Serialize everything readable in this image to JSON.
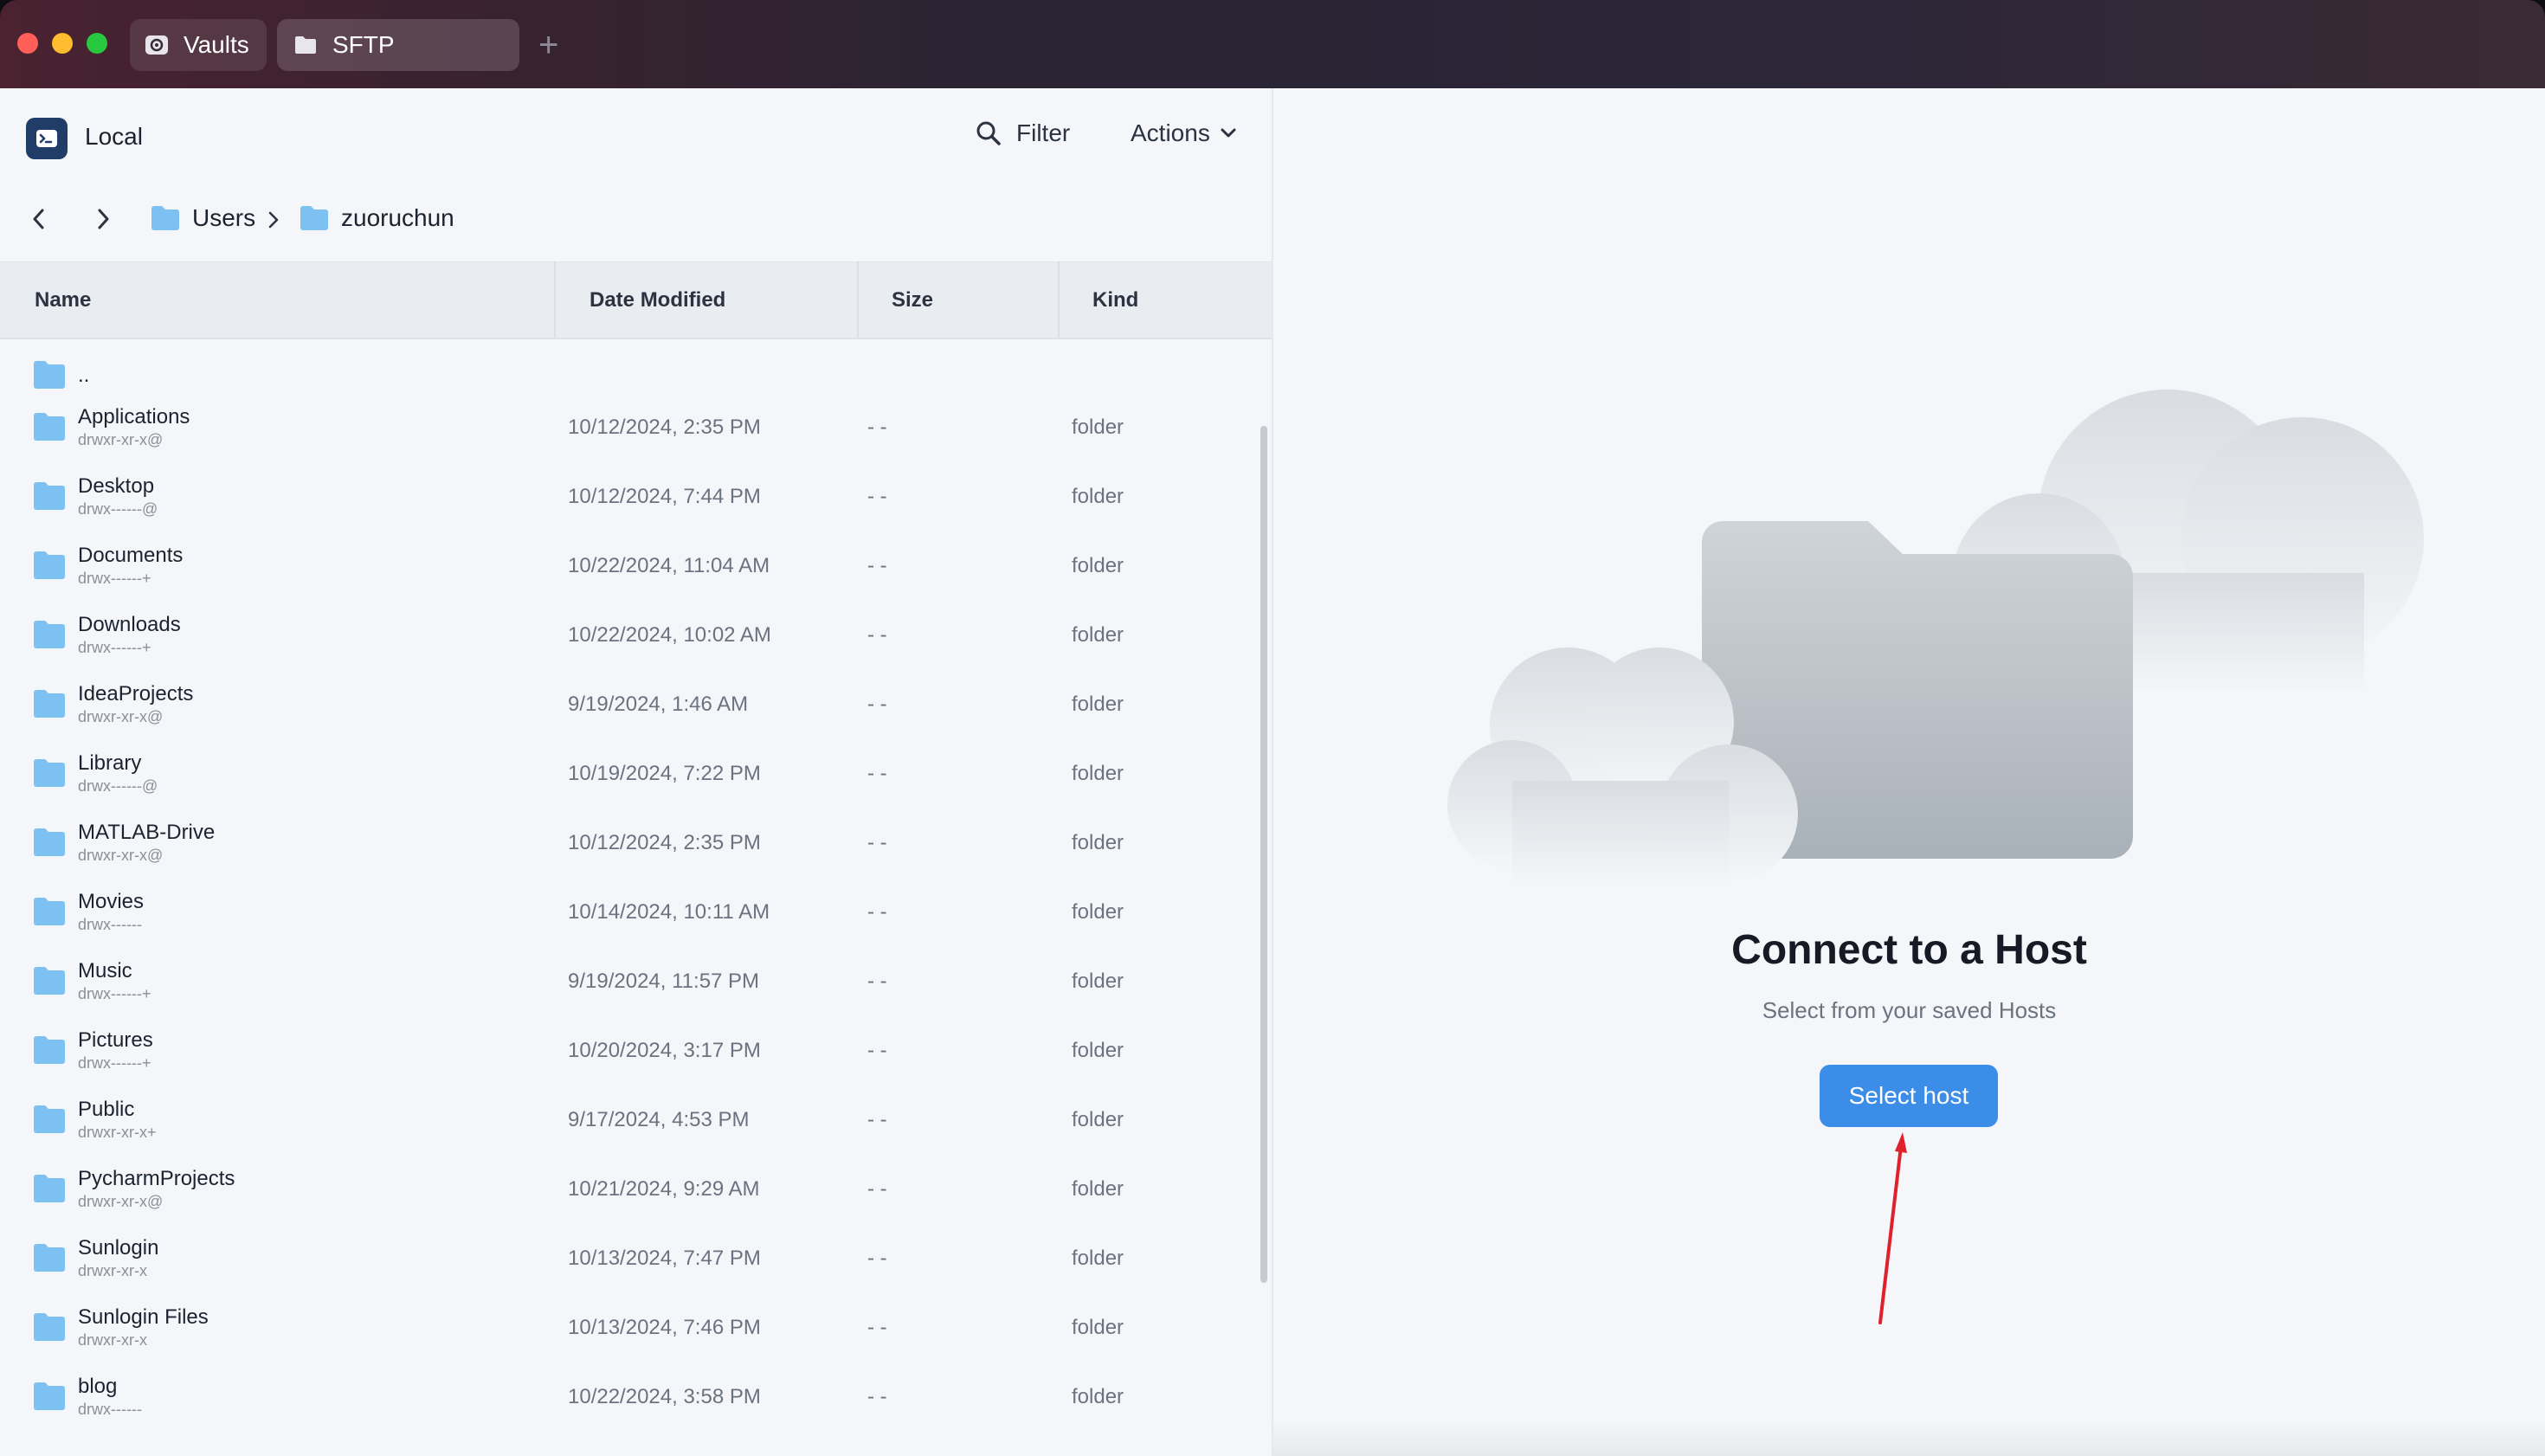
{
  "window": {
    "tabs": [
      {
        "label": "Vaults",
        "icon": "vault-icon"
      },
      {
        "label": "SFTP",
        "icon": "folder-icon"
      }
    ],
    "new_tab_icon": "plus-icon"
  },
  "left_pane": {
    "location_label": "Local",
    "filter_label": "Filter",
    "actions_label": "Actions",
    "breadcrumb": [
      "Users",
      "zuoruchun"
    ],
    "columns": [
      "Name",
      "Date Modified",
      "Size",
      "Kind"
    ],
    "parent_entry": "..",
    "files": [
      {
        "name": "Applications",
        "perm": "drwxr-xr-x@",
        "date": "10/12/2024, 2:35 PM",
        "size": "- -",
        "kind": "folder"
      },
      {
        "name": "Desktop",
        "perm": "drwx------@",
        "date": "10/12/2024, 7:44 PM",
        "size": "- -",
        "kind": "folder"
      },
      {
        "name": "Documents",
        "perm": "drwx------+",
        "date": "10/22/2024, 11:04 AM",
        "size": "- -",
        "kind": "folder"
      },
      {
        "name": "Downloads",
        "perm": "drwx------+",
        "date": "10/22/2024, 10:02 AM",
        "size": "- -",
        "kind": "folder"
      },
      {
        "name": "IdeaProjects",
        "perm": "drwxr-xr-x@",
        "date": "9/19/2024, 1:46 AM",
        "size": "- -",
        "kind": "folder"
      },
      {
        "name": "Library",
        "perm": "drwx------@",
        "date": "10/19/2024, 7:22 PM",
        "size": "- -",
        "kind": "folder"
      },
      {
        "name": "MATLAB-Drive",
        "perm": "drwxr-xr-x@",
        "date": "10/12/2024, 2:35 PM",
        "size": "- -",
        "kind": "folder"
      },
      {
        "name": "Movies",
        "perm": "drwx------",
        "date": "10/14/2024, 10:11 AM",
        "size": "- -",
        "kind": "folder"
      },
      {
        "name": "Music",
        "perm": "drwx------+",
        "date": "9/19/2024, 11:57 PM",
        "size": "- -",
        "kind": "folder"
      },
      {
        "name": "Pictures",
        "perm": "drwx------+",
        "date": "10/20/2024, 3:17 PM",
        "size": "- -",
        "kind": "folder"
      },
      {
        "name": "Public",
        "perm": "drwxr-xr-x+",
        "date": "9/17/2024, 4:53 PM",
        "size": "- -",
        "kind": "folder"
      },
      {
        "name": "PycharmProjects",
        "perm": "drwxr-xr-x@",
        "date": "10/21/2024, 9:29 AM",
        "size": "- -",
        "kind": "folder"
      },
      {
        "name": "Sunlogin",
        "perm": "drwxr-xr-x",
        "date": "10/13/2024, 7:47 PM",
        "size": "- -",
        "kind": "folder"
      },
      {
        "name": "Sunlogin Files",
        "perm": "drwxr-xr-x",
        "date": "10/13/2024, 7:46 PM",
        "size": "- -",
        "kind": "folder"
      },
      {
        "name": "blog",
        "perm": "drwx------",
        "date": "10/22/2024, 3:58 PM",
        "size": "- -",
        "kind": "folder"
      }
    ]
  },
  "right_pane": {
    "title": "Connect to a Host",
    "subtitle": "Select from your saved Hosts",
    "button_label": "Select host"
  },
  "colors": {
    "accent": "#3b8de8",
    "folder": "#7cc1f2",
    "annotation_arrow": "#e0202a"
  }
}
